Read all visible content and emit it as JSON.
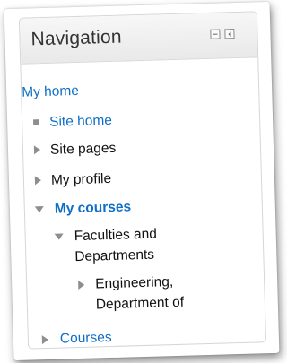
{
  "block": {
    "title": "Navigation",
    "dock_icon": "dock-icon",
    "hide_icon": "hide-block-icon"
  },
  "nav": {
    "my_home": "My home",
    "site_home": "Site home",
    "site_pages": "Site pages",
    "my_profile": "My profile",
    "my_courses": "My courses",
    "faculties_line1": "Faculties and",
    "faculties_line2": "Departments",
    "engineering_line1": "Engineering,",
    "engineering_line2": "Department of",
    "courses": "Courses"
  },
  "colors": {
    "link": "#0f6fc6",
    "text": "#111111",
    "icon": "#8e8e8e"
  }
}
